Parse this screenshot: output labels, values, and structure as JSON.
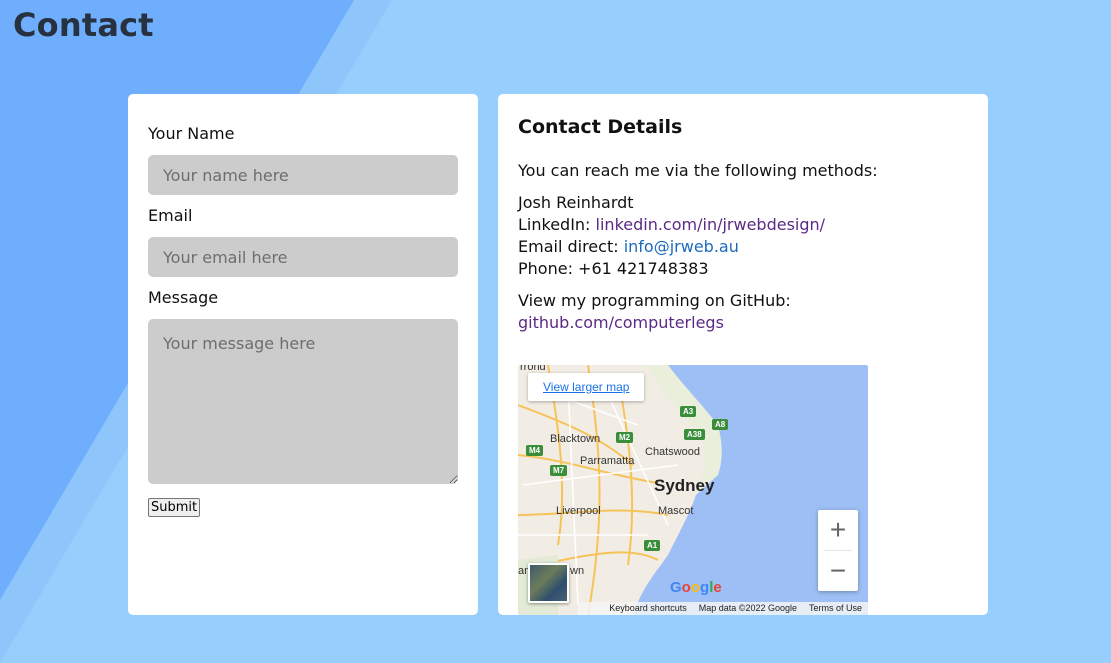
{
  "page": {
    "title": "Contact"
  },
  "form": {
    "name_label": "Your Name",
    "name_placeholder": "Your name here",
    "email_label": "Email",
    "email_placeholder": "Your email here",
    "message_label": "Message",
    "message_placeholder": "Your message here",
    "submit_label": "Submit"
  },
  "details": {
    "title": "Contact Details",
    "intro": "You can reach me via the following methods:",
    "name": "Josh Reinhardt",
    "linkedin_label": "LinkedIn: ",
    "linkedin_link": "linkedin.com/in/jrwebdesign/",
    "email_label": "Email direct: ",
    "email_link": "info@jrweb.au",
    "phone_label": "Phone: ",
    "phone_value": "+61 421748383",
    "github_label": "View my programming on GitHub: ",
    "github_link": "github.com/computerlegs"
  },
  "map": {
    "view_larger": "View larger map",
    "zoom_in": "+",
    "zoom_out": "−",
    "google": "Google",
    "footer": [
      "Keyboard shortcuts",
      "Map data ©2022 Google",
      "Terms of Use"
    ],
    "places": {
      "top": "rrond",
      "blacktown": "Blacktown",
      "parramatta": "Parramatta",
      "chatswood": "Chatswood",
      "sydney": "Sydney",
      "liverpool": "Liverpool",
      "mascot": "Mascot",
      "bottom_left": "am",
      "bottom_left_2": "wn"
    },
    "shields": {
      "a3": "A3",
      "a8": "A8",
      "a38": "A38",
      "m2": "M2",
      "m4": "M4",
      "m7": "M7",
      "a1": "A1"
    }
  },
  "colors": {
    "background": "#96cffd",
    "stripe_dark": "#6eaefc",
    "title": "#27313f",
    "input_bg": "#cccccc",
    "link_visited": "#5b2a86",
    "link_mail": "#1a6bbf",
    "water": "#9dbff5",
    "land": "#f1ede4"
  }
}
